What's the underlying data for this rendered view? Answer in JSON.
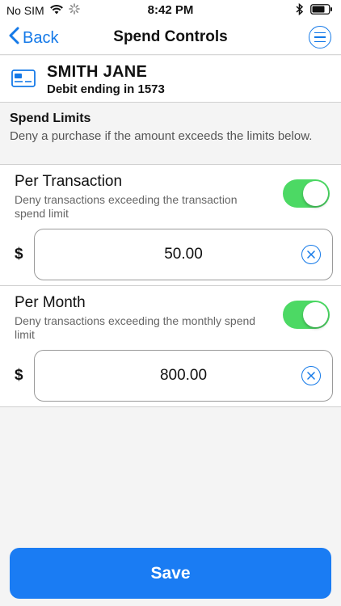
{
  "status_bar": {
    "carrier": "No SIM",
    "time": "8:42 PM"
  },
  "nav": {
    "back_label": "Back",
    "title": "Spend Controls"
  },
  "card": {
    "name": "SMITH JANE",
    "description": "Debit ending in 1573"
  },
  "spend_limits": {
    "title": "Spend Limits",
    "description": "Deny a purchase if the amount exceeds the limits below."
  },
  "per_transaction": {
    "title": "Per Transaction",
    "description": "Deny transactions exceeding the transaction spend limit",
    "enabled": true,
    "currency": "$",
    "amount": "50.00"
  },
  "per_month": {
    "title": "Per Month",
    "description": "Deny transactions exceeding the monthly spend limit",
    "enabled": true,
    "currency": "$",
    "amount": "800.00"
  },
  "save_label": "Save",
  "colors": {
    "accent": "#1479e8",
    "toggle_on": "#4cd964",
    "save_button": "#1a7cf3"
  },
  "icons": {
    "wifi": "wifi-icon",
    "activity": "spinner-icon",
    "bluetooth": "bluetooth-icon",
    "battery": "battery-icon",
    "back": "chevron-left-icon",
    "menu": "menu-icon",
    "card": "credit-card-icon",
    "clear": "clear-x-icon"
  }
}
